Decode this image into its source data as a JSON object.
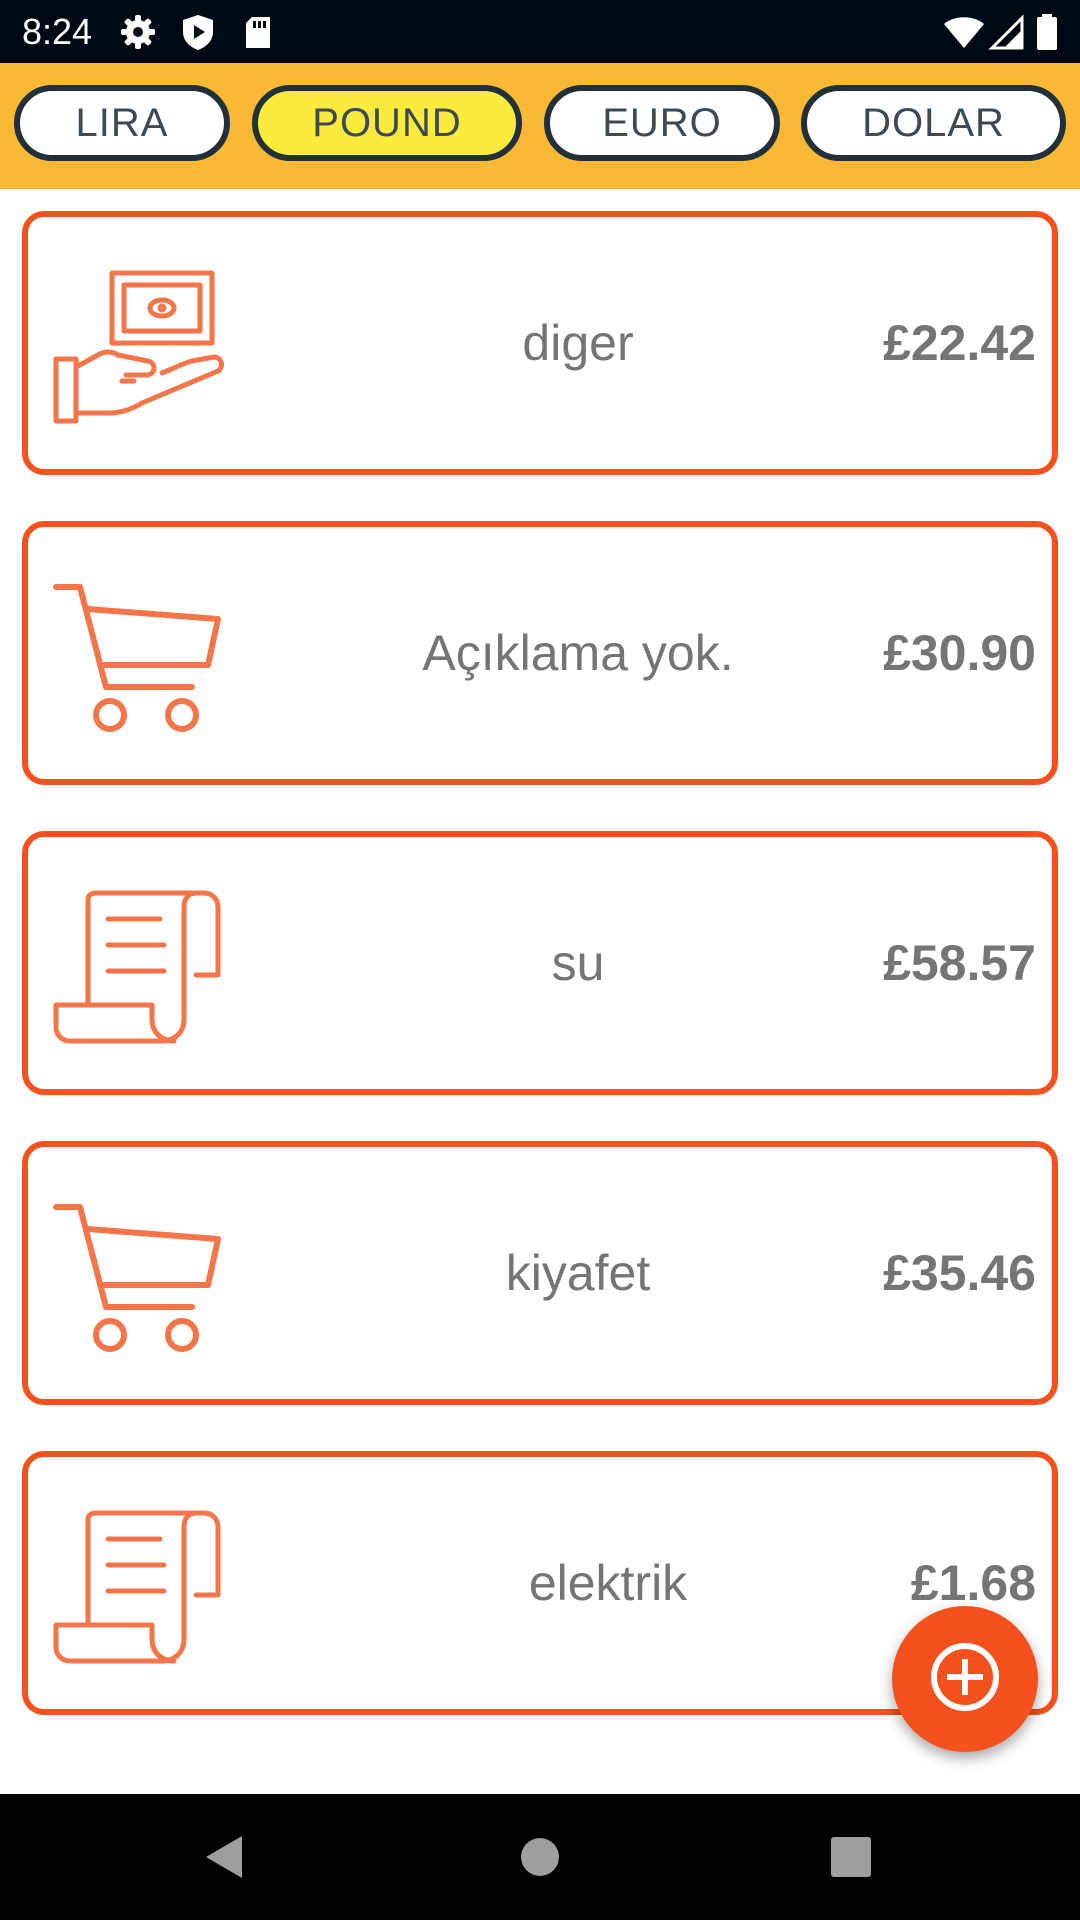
{
  "status_bar": {
    "time": "8:24",
    "icons": [
      "gear-icon",
      "shield-play-icon",
      "sd-card-icon",
      "wifi-icon",
      "cell-signal-icon",
      "battery-icon"
    ]
  },
  "tabs": [
    {
      "label": "LIRA",
      "active": false
    },
    {
      "label": "POUND",
      "active": true
    },
    {
      "label": "EURO",
      "active": false
    },
    {
      "label": "DOLAR",
      "active": false
    }
  ],
  "expenses": [
    {
      "icon": "money-hand-icon",
      "description": "diger",
      "amount": "£22.42"
    },
    {
      "icon": "shopping-cart-icon",
      "description": "Açıklama yok.",
      "amount": "£30.90"
    },
    {
      "icon": "receipt-icon",
      "description": "su",
      "amount": "£58.57"
    },
    {
      "icon": "shopping-cart-icon",
      "description": "kiyafet",
      "amount": "£35.46"
    },
    {
      "icon": "receipt-icon",
      "description": "elektrik",
      "amount": "£1.68"
    }
  ],
  "fab": {
    "icon": "add-circle-icon"
  },
  "nav_bar": {
    "icons": [
      "back-icon",
      "home-icon",
      "recents-icon"
    ]
  },
  "colors": {
    "accent": "#f4511e",
    "tab_bar": "#f9b935",
    "active_tab": "#fbeb3c",
    "status_bar": "#000a14"
  }
}
